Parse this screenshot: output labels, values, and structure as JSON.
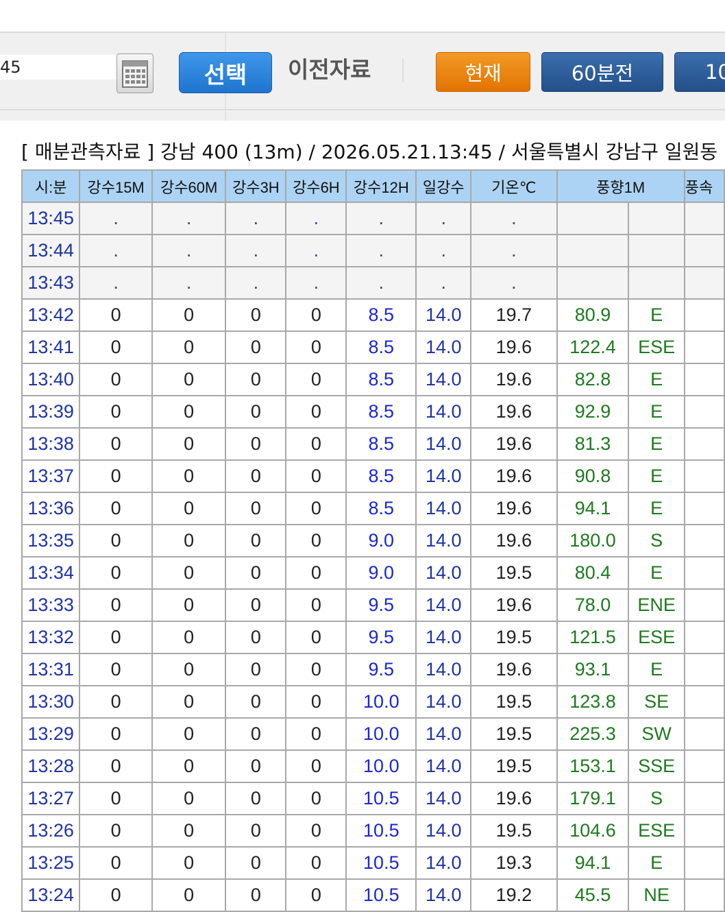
{
  "toolbar": {
    "date_value": "45",
    "select_label": "선택",
    "prev_label": "이전자료",
    "now_label": "현재",
    "min60_label": "60분전",
    "next_label": "10"
  },
  "heading": "[ 매분관측자료 ] 강남 400 (13m) / 2026.05.21.13:45 / 서울특별시 강남구 일원동",
  "table": {
    "headers": [
      "시:분",
      "강수15M",
      "강수60M",
      "강수3H",
      "강수6H",
      "강수12H",
      "일강수",
      "기온℃",
      "풍향1M",
      "풍속"
    ],
    "empty_rows": [
      {
        "time": "13:45",
        "cells": [
          ".",
          ".",
          ".",
          ".",
          ".",
          ".",
          "."
        ]
      },
      {
        "time": "13:44",
        "cells": [
          ".",
          ".",
          ".",
          ".",
          ".",
          ".",
          "."
        ]
      },
      {
        "time": "13:43",
        "cells": [
          ".",
          ".",
          ".",
          ".",
          ".",
          ".",
          "."
        ]
      }
    ],
    "rows": [
      {
        "time": "13:42",
        "r15m": "0",
        "r60m": "0",
        "r3h": "0",
        "r6h": "0",
        "r12h": "8.5",
        "day": "14.0",
        "temp": "19.7",
        "wd_deg": "80.9",
        "wd_dir": "E"
      },
      {
        "time": "13:41",
        "r15m": "0",
        "r60m": "0",
        "r3h": "0",
        "r6h": "0",
        "r12h": "8.5",
        "day": "14.0",
        "temp": "19.6",
        "wd_deg": "122.4",
        "wd_dir": "ESE"
      },
      {
        "time": "13:40",
        "r15m": "0",
        "r60m": "0",
        "r3h": "0",
        "r6h": "0",
        "r12h": "8.5",
        "day": "14.0",
        "temp": "19.6",
        "wd_deg": "82.8",
        "wd_dir": "E"
      },
      {
        "time": "13:39",
        "r15m": "0",
        "r60m": "0",
        "r3h": "0",
        "r6h": "0",
        "r12h": "8.5",
        "day": "14.0",
        "temp": "19.6",
        "wd_deg": "92.9",
        "wd_dir": "E"
      },
      {
        "time": "13:38",
        "r15m": "0",
        "r60m": "0",
        "r3h": "0",
        "r6h": "0",
        "r12h": "8.5",
        "day": "14.0",
        "temp": "19.6",
        "wd_deg": "81.3",
        "wd_dir": "E"
      },
      {
        "time": "13:37",
        "r15m": "0",
        "r60m": "0",
        "r3h": "0",
        "r6h": "0",
        "r12h": "8.5",
        "day": "14.0",
        "temp": "19.6",
        "wd_deg": "90.8",
        "wd_dir": "E"
      },
      {
        "time": "13:36",
        "r15m": "0",
        "r60m": "0",
        "r3h": "0",
        "r6h": "0",
        "r12h": "8.5",
        "day": "14.0",
        "temp": "19.6",
        "wd_deg": "94.1",
        "wd_dir": "E"
      },
      {
        "time": "13:35",
        "r15m": "0",
        "r60m": "0",
        "r3h": "0",
        "r6h": "0",
        "r12h": "9.0",
        "day": "14.0",
        "temp": "19.6",
        "wd_deg": "180.0",
        "wd_dir": "S"
      },
      {
        "time": "13:34",
        "r15m": "0",
        "r60m": "0",
        "r3h": "0",
        "r6h": "0",
        "r12h": "9.0",
        "day": "14.0",
        "temp": "19.5",
        "wd_deg": "80.4",
        "wd_dir": "E"
      },
      {
        "time": "13:33",
        "r15m": "0",
        "r60m": "0",
        "r3h": "0",
        "r6h": "0",
        "r12h": "9.5",
        "day": "14.0",
        "temp": "19.6",
        "wd_deg": "78.0",
        "wd_dir": "ENE"
      },
      {
        "time": "13:32",
        "r15m": "0",
        "r60m": "0",
        "r3h": "0",
        "r6h": "0",
        "r12h": "9.5",
        "day": "14.0",
        "temp": "19.5",
        "wd_deg": "121.5",
        "wd_dir": "ESE"
      },
      {
        "time": "13:31",
        "r15m": "0",
        "r60m": "0",
        "r3h": "0",
        "r6h": "0",
        "r12h": "9.5",
        "day": "14.0",
        "temp": "19.6",
        "wd_deg": "93.1",
        "wd_dir": "E"
      },
      {
        "time": "13:30",
        "r15m": "0",
        "r60m": "0",
        "r3h": "0",
        "r6h": "0",
        "r12h": "10.0",
        "day": "14.0",
        "temp": "19.5",
        "wd_deg": "123.8",
        "wd_dir": "SE"
      },
      {
        "time": "13:29",
        "r15m": "0",
        "r60m": "0",
        "r3h": "0",
        "r6h": "0",
        "r12h": "10.0",
        "day": "14.0",
        "temp": "19.5",
        "wd_deg": "225.3",
        "wd_dir": "SW"
      },
      {
        "time": "13:28",
        "r15m": "0",
        "r60m": "0",
        "r3h": "0",
        "r6h": "0",
        "r12h": "10.0",
        "day": "14.0",
        "temp": "19.5",
        "wd_deg": "153.1",
        "wd_dir": "SSE"
      },
      {
        "time": "13:27",
        "r15m": "0",
        "r60m": "0",
        "r3h": "0",
        "r6h": "0",
        "r12h": "10.5",
        "day": "14.0",
        "temp": "19.6",
        "wd_deg": "179.1",
        "wd_dir": "S"
      },
      {
        "time": "13:26",
        "r15m": "0",
        "r60m": "0",
        "r3h": "0",
        "r6h": "0",
        "r12h": "10.5",
        "day": "14.0",
        "temp": "19.5",
        "wd_deg": "104.6",
        "wd_dir": "ESE"
      },
      {
        "time": "13:25",
        "r15m": "0",
        "r60m": "0",
        "r3h": "0",
        "r6h": "0",
        "r12h": "10.5",
        "day": "14.0",
        "temp": "19.3",
        "wd_deg": "94.1",
        "wd_dir": "E"
      },
      {
        "time": "13:24",
        "r15m": "0",
        "r60m": "0",
        "r3h": "0",
        "r6h": "0",
        "r12h": "10.5",
        "day": "14.0",
        "temp": "19.2",
        "wd_deg": "45.5",
        "wd_dir": "NE"
      }
    ]
  },
  "colors": {
    "select_button": "#1f75cf",
    "now_button": "#e27300",
    "nav_button": "#244f8a",
    "header_bg": "#acd3f3",
    "time_text": "#1f33a8",
    "rain12h_text": "#1a26d6",
    "wind_text": "#1d7a1d"
  },
  "icons": {
    "calendar": "calendar-icon"
  }
}
